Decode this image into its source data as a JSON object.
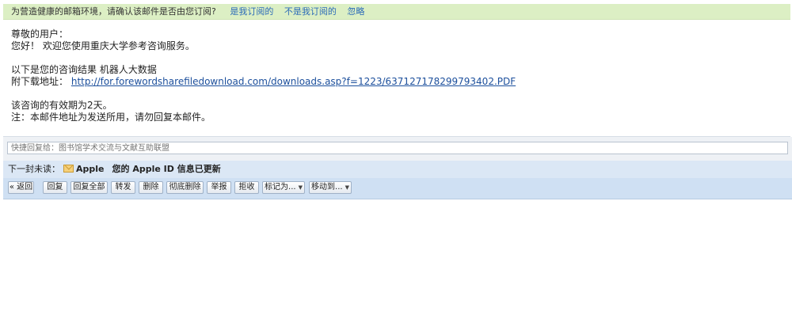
{
  "notice": {
    "question": "为营造健康的邮箱环境，请确认该邮件是否由您订阅?",
    "options": [
      "是我订阅的",
      "不是我订阅的",
      "忽略"
    ]
  },
  "mail": {
    "greeting": "尊敬的用户：",
    "welcome": "您好！ 欢迎您使用重庆大学参考咨询服务。",
    "result_line": "以下是您的咨询结果 机器人大数据",
    "download_label": "附下载地址：",
    "download_url": "http://for.forewordsharefiledownload.com/downloads.asp?f=1223/637127178299793402.PDF",
    "validity": "该咨询的有效期为2天。",
    "note": "注：本邮件地址为发送所用，请勿回复本邮件。"
  },
  "quick_reply": {
    "placeholder": "快捷回复给：图书馆学术交流与文献互助联盟"
  },
  "next_mail": {
    "label": "下一封未读：",
    "sender": "Apple",
    "subject": "您的 Apple ID 信息已更新"
  },
  "toolbar": {
    "back": "« 返回",
    "reply": "回复",
    "reply_all": "回复全部",
    "forward": "转发",
    "delete": "删除",
    "perm_delete": "彻底删除",
    "report": "举报",
    "reject": "拒收",
    "mark_as": "标记为...",
    "move_to": "移动到..."
  }
}
